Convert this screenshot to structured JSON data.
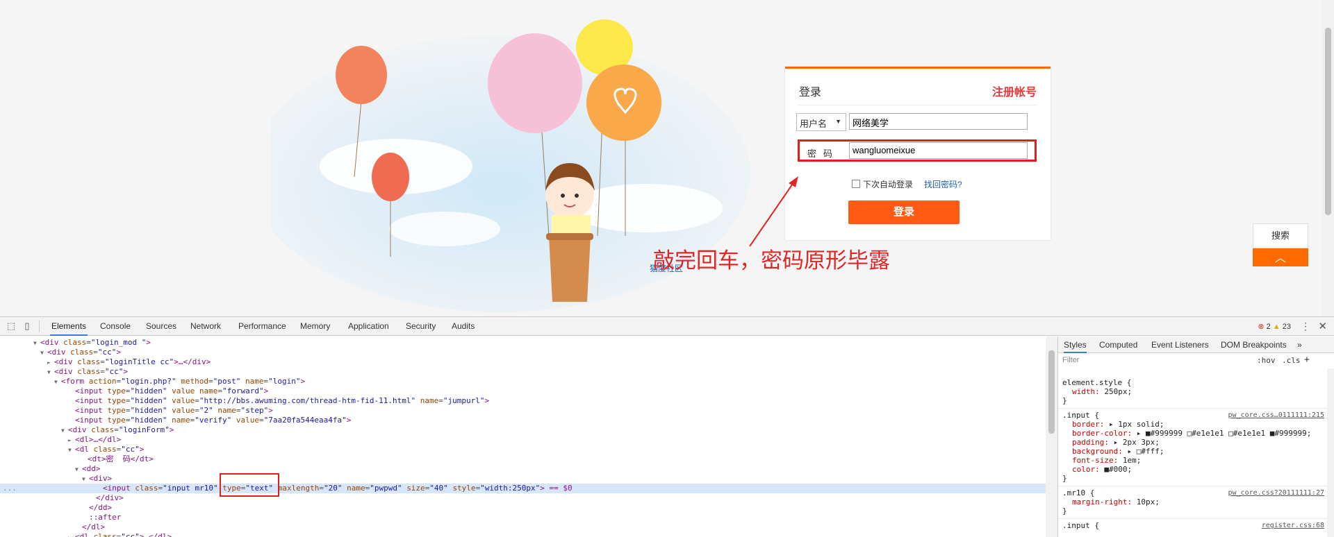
{
  "login": {
    "title": "登录",
    "register": "注册帐号",
    "user_type": "用户名",
    "username_value": "网络美学",
    "password_label": "密码",
    "password_value": "wangluomeixue",
    "auto_login": "下次自动登录",
    "forgot": "找回密码?",
    "submit": "登录"
  },
  "annotation": "敲完回车，密码原形毕露",
  "community_link": "猫度社区",
  "side": {
    "search": "搜索",
    "top": "︿"
  },
  "colors": {
    "accent": "#ff6a00",
    "highlight_red": "#d9221c",
    "devtools_blue": "#3879d9"
  },
  "devtools": {
    "tabs": [
      "Elements",
      "Console",
      "Sources",
      "Network",
      "Performance",
      "Memory",
      "Application",
      "Security",
      "Audits"
    ],
    "active_tab": "Elements",
    "errors": "2",
    "warnings": "23",
    "dom": [
      "▼<div class=\"login_mod \">",
      "▼<div class=\"cc\">",
      "►<div class=\"loginTitle cc\">…</div>",
      "▼<div class=\"cc\">",
      "▼<form action=\"login.php?\" method=\"post\" name=\"login\">",
      "<input type=\"hidden\" value name=\"forward\">",
      "<input type=\"hidden\" value=\"http://bbs.awuming.com/thread-htm-fid-11.html\" name=\"jumpurl\">",
      "<input type=\"hidden\" value=\"2\" name=\"step\">",
      "<input type=\"hidden\" name=\"verify\" value=\"7aa20fa544eaa4fa\">",
      "▼<div class=\"loginForm\">",
      "►<dl>…</dl>",
      "▼<dl class=\"cc\">",
      "<dt>密  码</dt>",
      "▼<dd>",
      "▼<div>",
      "<input class=\"input mr10\" type=\"text\" maxlength=\"20\" name=\"pwpwd\" size=\"40\" style=\"width:250px\"> == $0",
      "</div>",
      "</dd>",
      "::after",
      "</dl>",
      "►<dl class=\"cc\">…</dl>"
    ],
    "styles_tabs": [
      "Styles",
      "Computed",
      "Event Listeners",
      "DOM Breakpoints",
      "»"
    ],
    "filter_placeholder": "Filter",
    "hov": ":hov",
    "cls": ".cls",
    "plus": "+",
    "rules": [
      {
        "selector": "element.style {",
        "source": "",
        "props": [
          "width: 250px;"
        ]
      },
      {
        "selector": ".input {",
        "source": "pw_core.css…0111111:215",
        "props": [
          "border: ▸ 1px solid;",
          "border-color: ▸ ■#999999 □#e1e1e1 □#e1e1e1 ■#999999;",
          "padding: ▸ 2px 3px;",
          "background: ▸ □#fff;",
          "font-size: 1em;",
          "color: ■#000;"
        ]
      },
      {
        "selector": ".mr10 {",
        "source": "pw_core.css?20111111:27",
        "props": [
          "margin-right: 10px;"
        ]
      },
      {
        "selector": ".input {",
        "source": "register.css:68",
        "props": []
      }
    ]
  }
}
